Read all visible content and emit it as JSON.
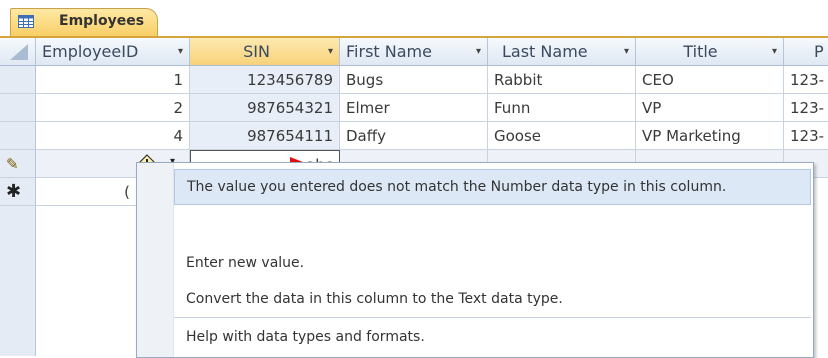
{
  "tab": {
    "title": "Employees"
  },
  "columns": [
    {
      "label": "EmployeeID",
      "arrow": "▾"
    },
    {
      "label": "SIN",
      "arrow": "▾"
    },
    {
      "label": "First Name",
      "arrow": "▾"
    },
    {
      "label": "Last Name",
      "arrow": "▾"
    },
    {
      "label": "Title",
      "arrow": "▾"
    },
    {
      "label": "P",
      "arrow": ""
    }
  ],
  "rows": [
    {
      "employee_id": "1",
      "sin": "123456789",
      "first_name": "Bugs",
      "last_name": "Rabbit",
      "title": "CEO",
      "phone": "123-"
    },
    {
      "employee_id": "2",
      "sin": "987654321",
      "first_name": "Elmer",
      "last_name": "Funn",
      "title": "VP",
      "phone": "123-"
    },
    {
      "employee_id": "4",
      "sin": "987654111",
      "first_name": "Daffy",
      "last_name": "Goose",
      "title": "VP Marketing",
      "phone": "123-"
    }
  ],
  "edit_row": {
    "sin_value": "abc",
    "selector_glyph": "✎"
  },
  "new_row": {
    "selector_glyph": "✱",
    "employee_id_partial": "("
  },
  "error_menu": {
    "header": "The value you entered does not match the Number data type in this column.",
    "items": [
      "Enter new value.",
      "Convert the data in this column to the Text data type.",
      "Help with data types and formats."
    ]
  },
  "colors": {
    "accent_tab": "#f8cf67",
    "arrow": "#e01010",
    "selected_column": "#f8d27a"
  }
}
